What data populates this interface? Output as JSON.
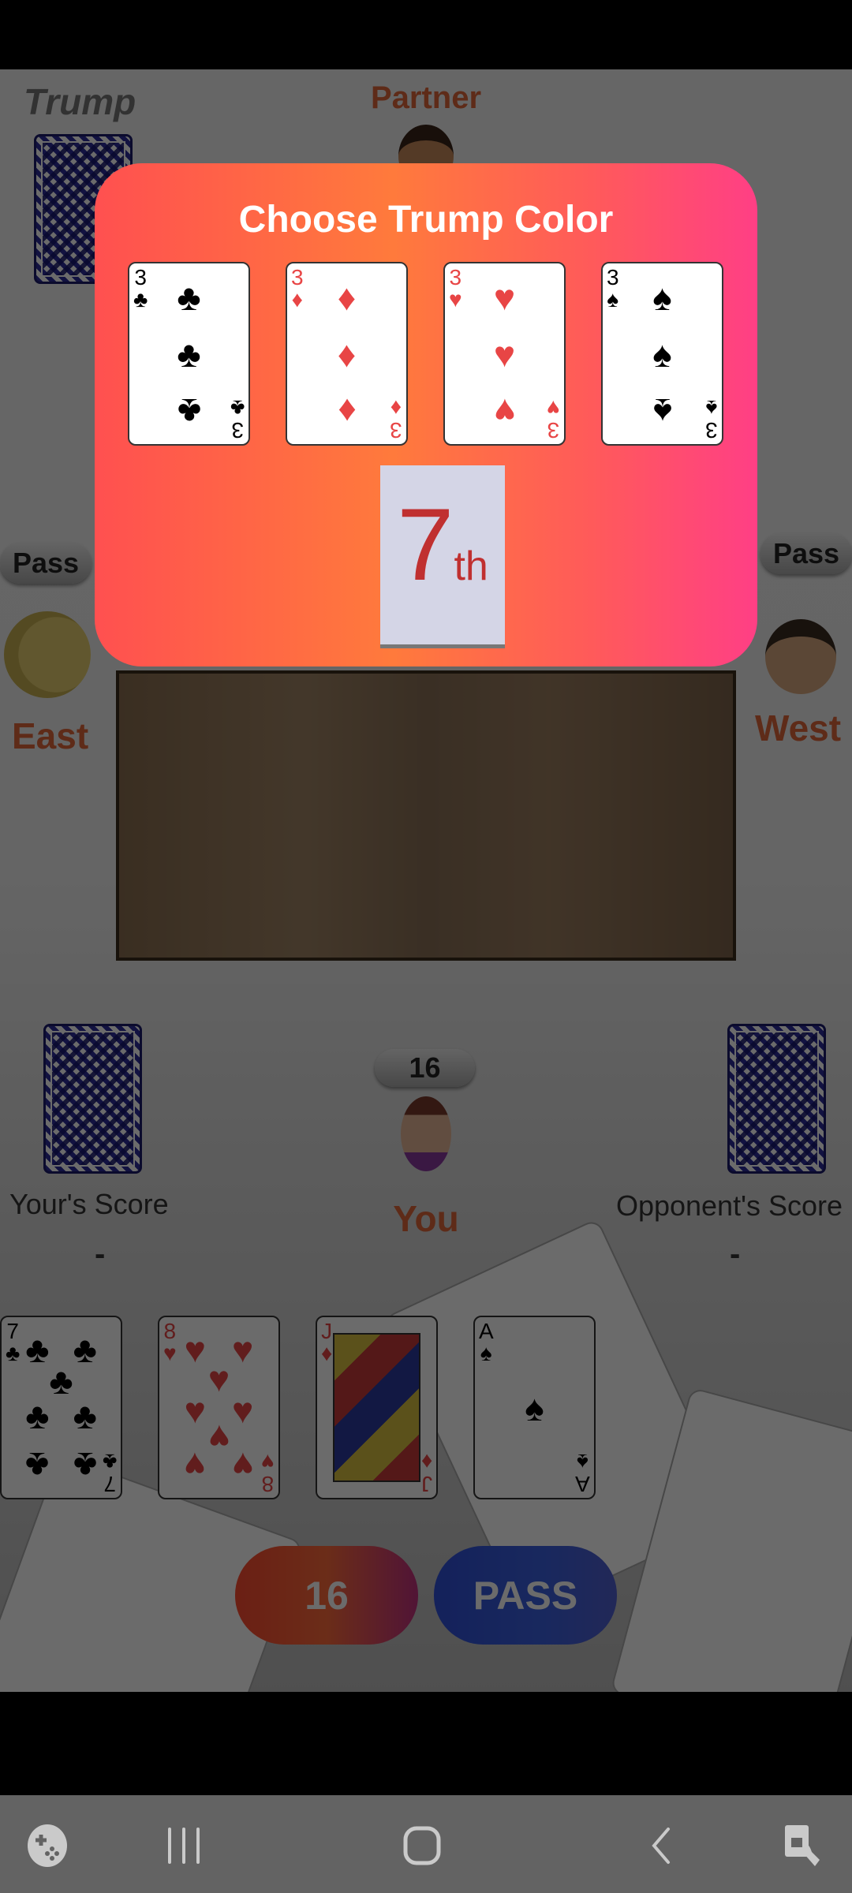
{
  "players": {
    "partner": "Partner",
    "east": "East",
    "west": "West",
    "you": "You"
  },
  "trump_label": "Trump",
  "east_status": "Pass",
  "west_status": "Pass",
  "bid_badge": "16",
  "scores": {
    "yours_label": "Your's Score",
    "yours_value": "-",
    "opponent_label": "Opponent's Score",
    "opponent_value": "-"
  },
  "modal": {
    "title": "Choose Trump Color",
    "options": [
      {
        "rank": "3",
        "suit": "♣",
        "color": "black",
        "name": "clubs"
      },
      {
        "rank": "3",
        "suit": "♦",
        "color": "red",
        "name": "diamonds"
      },
      {
        "rank": "3",
        "suit": "♥",
        "color": "red",
        "name": "hearts"
      },
      {
        "rank": "3",
        "suit": "♠",
        "color": "black",
        "name": "spades"
      }
    ],
    "position_number": "7",
    "position_suffix": "th"
  },
  "hand": [
    {
      "rank": "7",
      "suit": "♣",
      "color": "black",
      "name": "7-clubs"
    },
    {
      "rank": "8",
      "suit": "♥",
      "color": "red",
      "name": "8-hearts"
    },
    {
      "rank": "J",
      "suit": "♦",
      "color": "red",
      "name": "jack-diamonds"
    },
    {
      "rank": "A",
      "suit": "♠",
      "color": "black",
      "name": "ace-spades"
    }
  ],
  "buttons": {
    "bid": "16",
    "pass": "PASS",
    "bid_color": "#e8402a",
    "pass_color": "#2f4fd8"
  },
  "nav": [
    "game-controller-icon",
    "recent-apps-icon",
    "home-icon",
    "back-icon",
    "touch-lock-icon"
  ],
  "accent": "#e0663a"
}
